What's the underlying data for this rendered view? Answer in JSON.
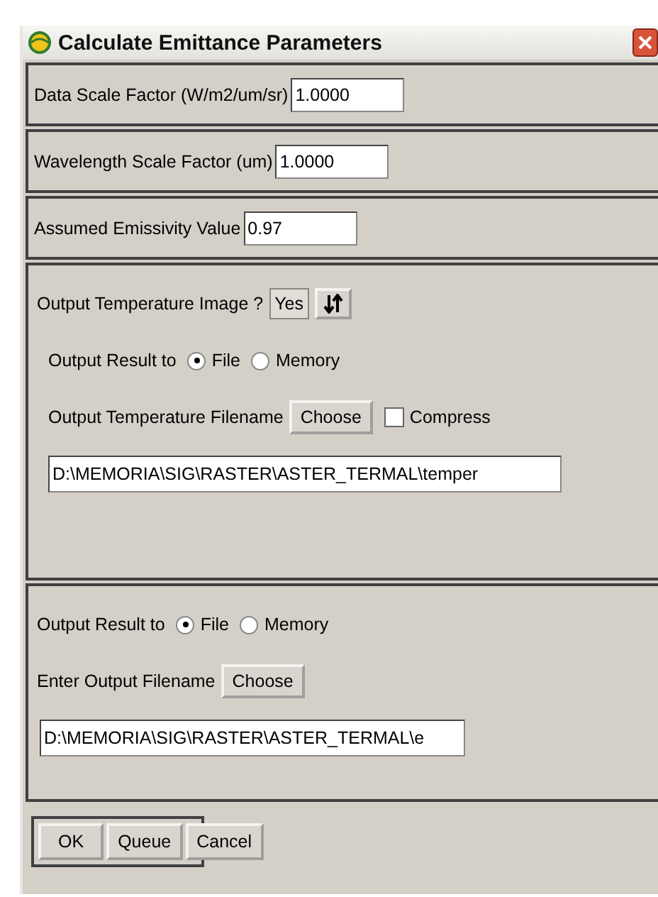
{
  "window": {
    "title": "Calculate Emittance Parameters"
  },
  "fields": [
    {
      "label": "Data Scale Factor (W/m2/um/sr)",
      "value": "1.0000"
    },
    {
      "label": "Wavelength Scale Factor (um)",
      "value": "1.0000"
    },
    {
      "label": "Assumed Emissivity Value",
      "value": "0.97"
    }
  ],
  "temperature_panel": {
    "label": "Output Temperature Image ?",
    "toggle_value": "Yes",
    "output_label": "Output Result to",
    "options": [
      {
        "label": "File",
        "selected": true
      },
      {
        "label": "Memory",
        "selected": false
      }
    ],
    "filename_label": "Output Temperature Filename",
    "choose": "Choose",
    "compress": {
      "label": "Compress",
      "checked": false
    },
    "path": "D:\\MEMORIA\\SIG\\RASTER\\ASTER_TERMAL\\temper"
  },
  "output_panel": {
    "output_label": "Output Result to",
    "options": [
      {
        "label": "File",
        "selected": true
      },
      {
        "label": "Memory",
        "selected": false
      }
    ],
    "filename_label": "Enter Output Filename",
    "choose": "Choose",
    "path": "D:\\MEMORIA\\SIG\\RASTER\\ASTER_TERMAL\\e"
  },
  "buttons": [
    "OK",
    "Queue",
    "Cancel"
  ]
}
